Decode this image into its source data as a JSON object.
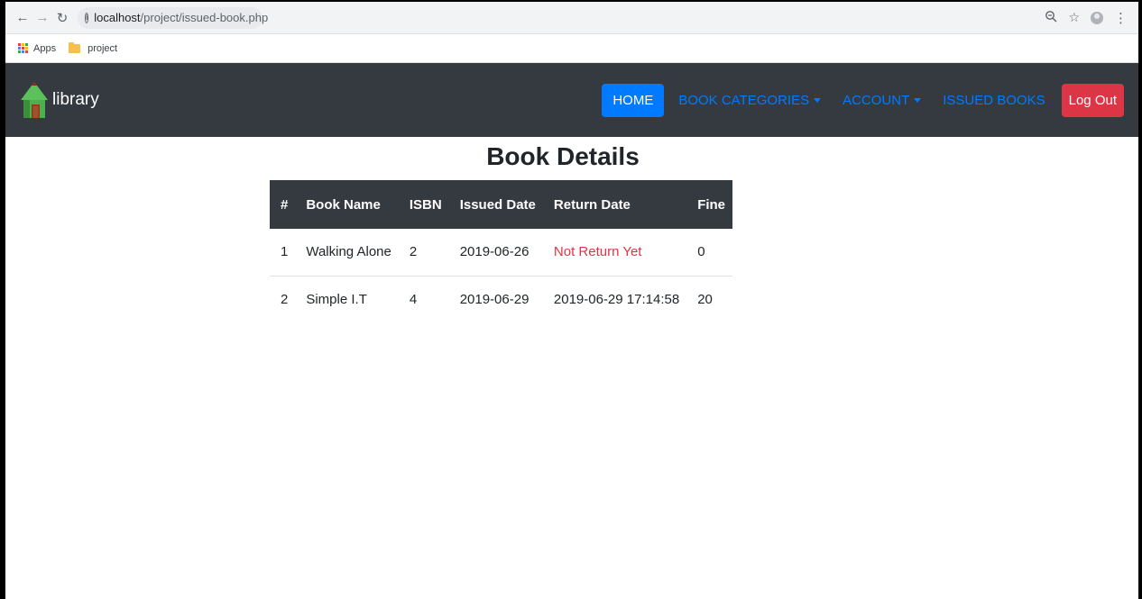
{
  "browser": {
    "url_host": "localhost",
    "url_path": "/project/issued-book.php",
    "bookmarks": [
      {
        "label": "Apps"
      },
      {
        "label": "project"
      }
    ]
  },
  "navbar": {
    "brand": "library",
    "items": [
      {
        "label": "HOME",
        "active": true
      },
      {
        "label": "BOOK CATEGORIES",
        "dropdown": true
      },
      {
        "label": "ACCOUNT",
        "dropdown": true
      },
      {
        "label": "ISSUED BOOKS"
      }
    ],
    "logout_label": "Log Out"
  },
  "main": {
    "title": "Book Details",
    "table": {
      "headers": [
        "#",
        "Book Name",
        "ISBN",
        "Issued Date",
        "Return Date",
        "Fine"
      ],
      "rows": [
        [
          "1",
          "Walking Alone",
          "2",
          "2019-06-26",
          "Not Return Yet",
          "0"
        ],
        [
          "2",
          "Simple I.T",
          "4",
          "2019-06-29",
          "2019-06-29 17:14:58",
          "20"
        ]
      ]
    }
  },
  "colors": {
    "navbar_bg": "#343a40",
    "primary": "#007bff",
    "danger": "#dc3545"
  }
}
